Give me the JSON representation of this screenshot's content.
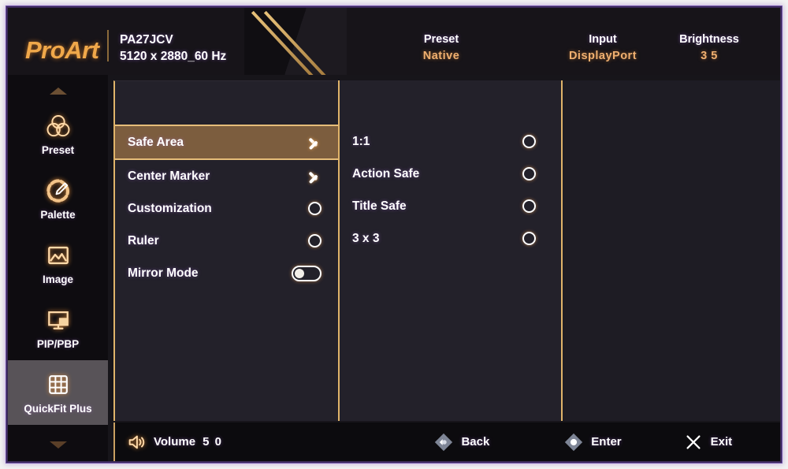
{
  "header": {
    "brand": "ProArt",
    "model": "PA27JCV",
    "resolution": "5120 x 2880_60 Hz",
    "status": [
      {
        "label": "Preset",
        "value": "Native"
      },
      {
        "label": "Input",
        "value": "DisplayPort"
      },
      {
        "label": "Brightness",
        "value": "3 5"
      }
    ]
  },
  "sidebar": {
    "scroll_up_icon": "chevron-up-icon",
    "scroll_down_icon": "chevron-down-icon",
    "items": [
      {
        "label": "Preset",
        "icon": "venn-circles-icon",
        "active": false
      },
      {
        "label": "Palette",
        "icon": "color-picker-icon",
        "active": false
      },
      {
        "label": "Image",
        "icon": "picture-icon",
        "active": false
      },
      {
        "label": "PIP/PBP",
        "icon": "pip-monitor-icon",
        "active": false
      },
      {
        "label": "QuickFit Plus",
        "icon": "grid-icon",
        "active": true
      }
    ]
  },
  "menu": {
    "items": [
      {
        "label": "Safe Area",
        "control": "chevron",
        "selected": true,
        "value": ""
      },
      {
        "label": "Center Marker",
        "control": "chevron",
        "selected": false,
        "value": ""
      },
      {
        "label": "Customization",
        "control": "radio",
        "selected": false,
        "value": "off"
      },
      {
        "label": "Ruler",
        "control": "radio",
        "selected": false,
        "value": "off"
      },
      {
        "label": "Mirror Mode",
        "control": "toggle",
        "selected": false,
        "value": "off"
      }
    ]
  },
  "submenu": {
    "options": [
      {
        "label": "1:1",
        "selected": false
      },
      {
        "label": "Action Safe",
        "selected": false
      },
      {
        "label": "Title Safe",
        "selected": false
      },
      {
        "label": "3 x 3",
        "selected": false
      }
    ]
  },
  "footer": {
    "volume_icon": "speaker-icon",
    "volume_label": "Volume",
    "volume_value": "5 0",
    "back_icon": "joystick-left-icon",
    "back_label": "Back",
    "enter_icon": "joystick-center-icon",
    "enter_label": "Enter",
    "exit_icon": "close-x-icon",
    "exit_label": "Exit"
  },
  "colors": {
    "accent_gold": "#e0b46a",
    "brand_orange": "#f0a84a",
    "highlight_row": "#7c5d3e",
    "sidebar_active": "#585358",
    "panel_bg": "#23212a",
    "screen_bg": "#17151a"
  }
}
